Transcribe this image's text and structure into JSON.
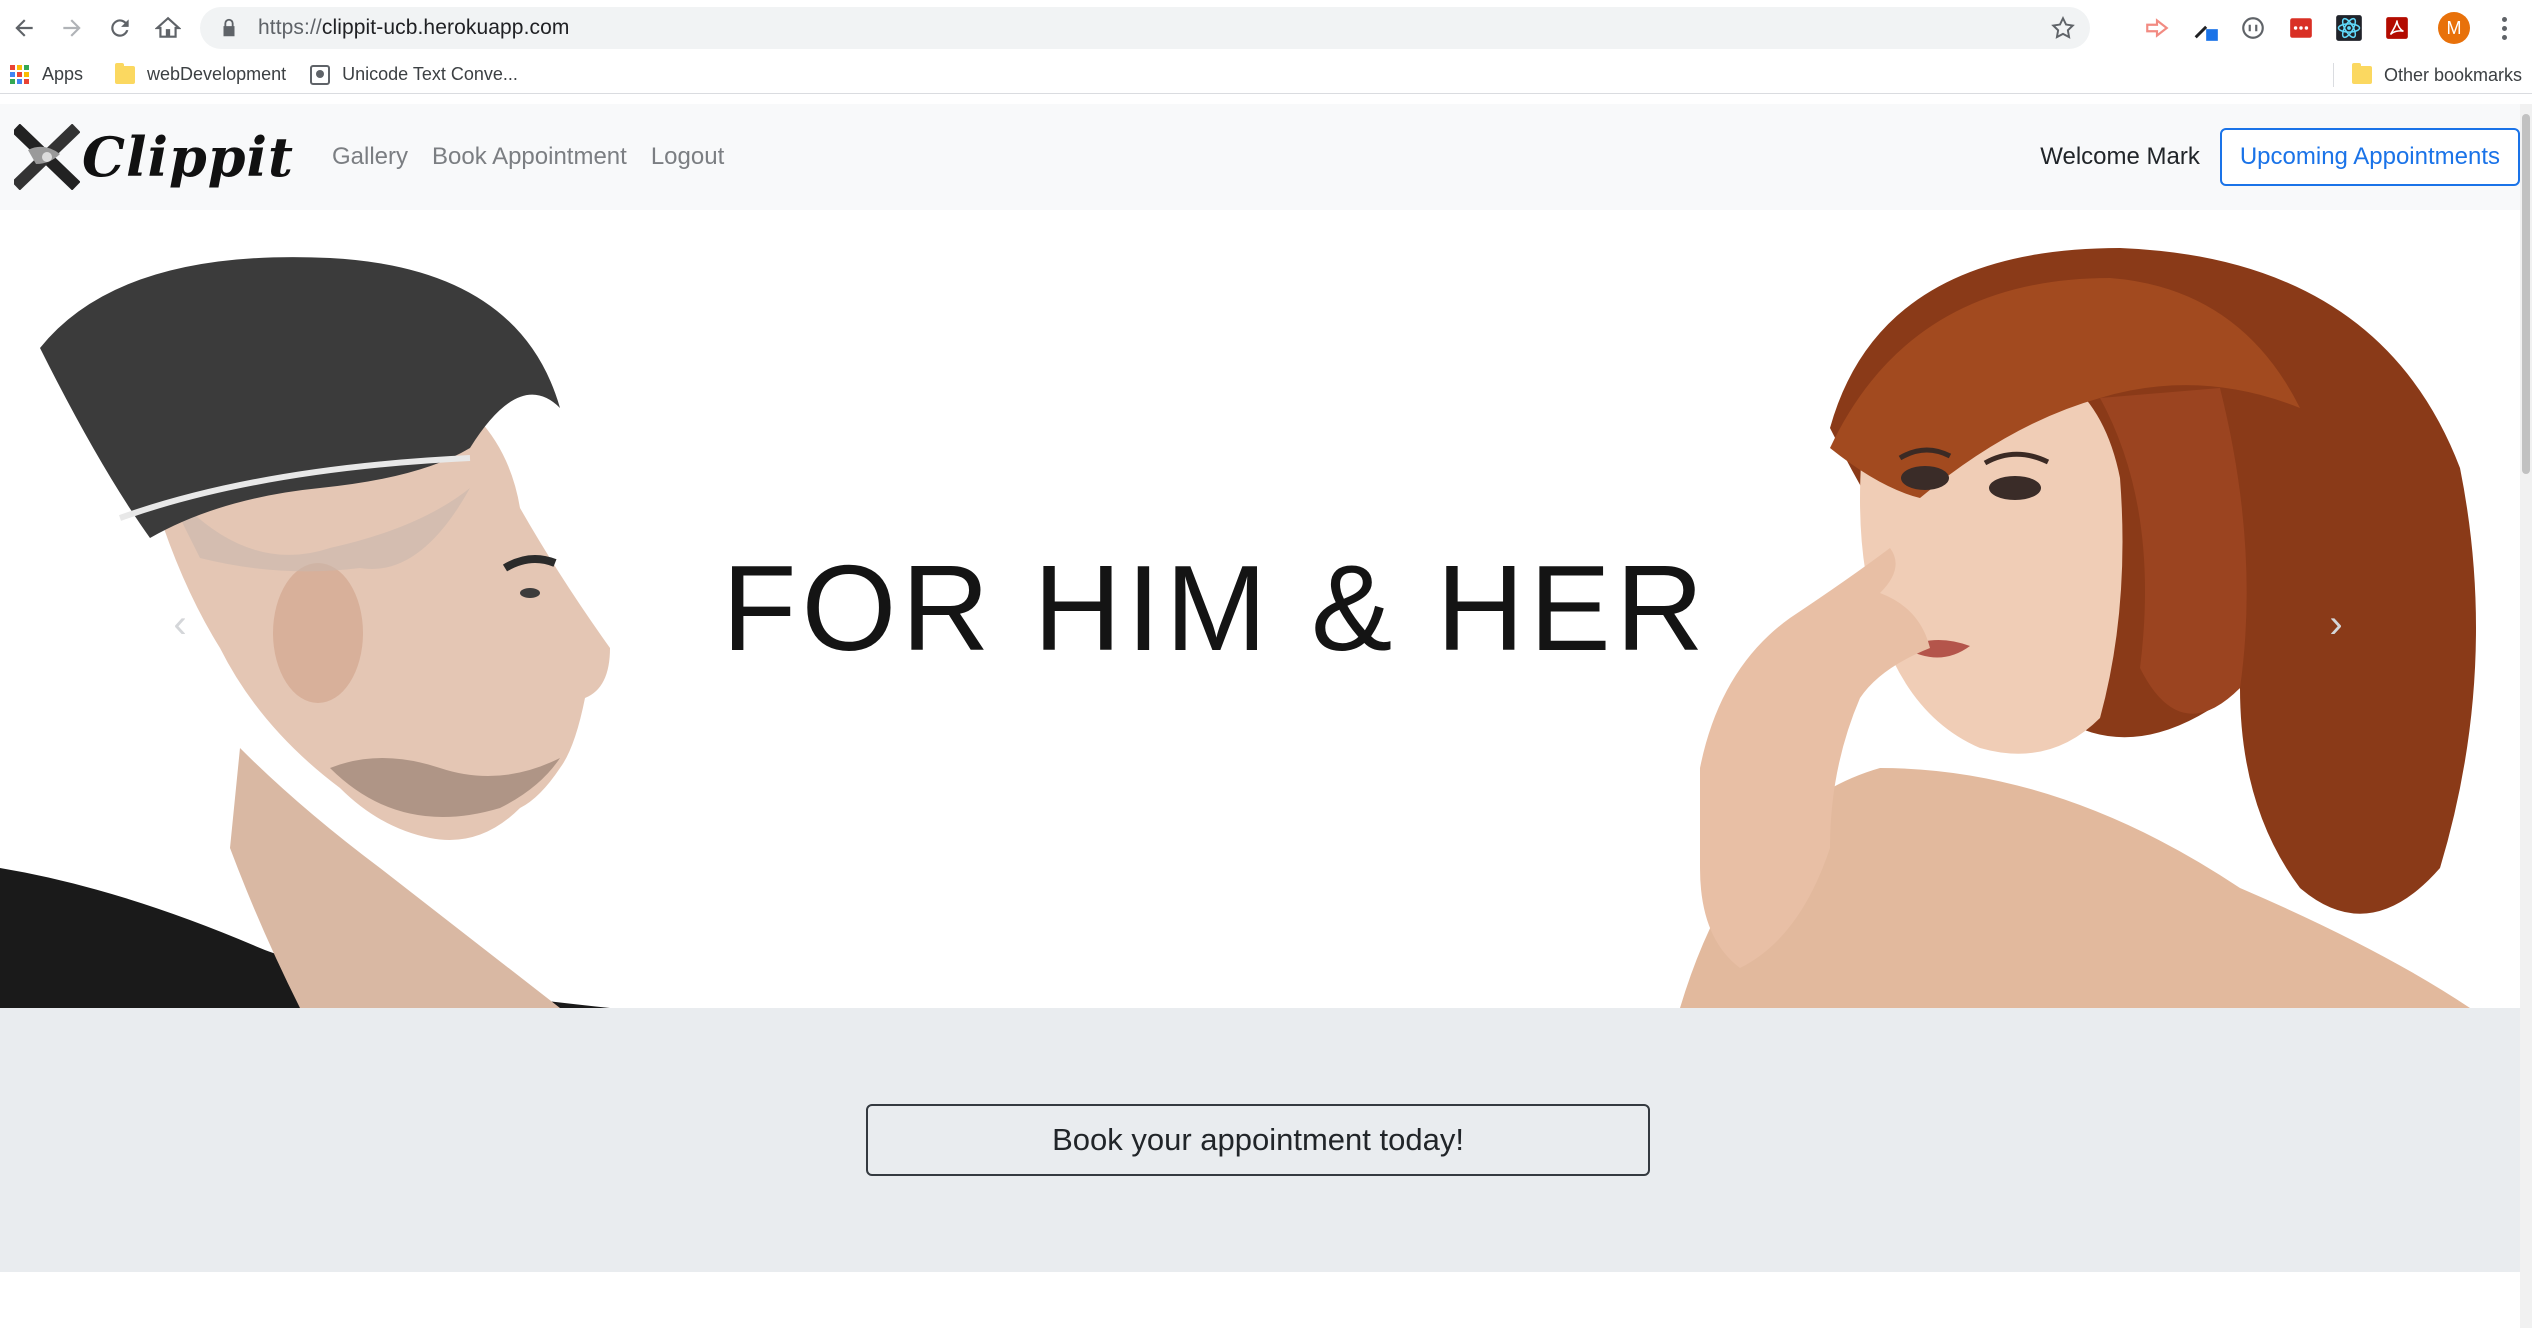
{
  "browser": {
    "url_scheme": "https://",
    "url_host": "clippit-ucb.herokuapp.com",
    "profile_initial": "M",
    "bookmarks": [
      {
        "label": "Apps",
        "icon": "apps-grid-icon"
      },
      {
        "label": "webDevelopment",
        "icon": "folder-icon"
      },
      {
        "label": "Unicode Text Conve...",
        "icon": "page-icon"
      }
    ],
    "other_bookmarks": "Other bookmarks"
  },
  "site": {
    "brand": "Clippit",
    "nav_links": [
      "Gallery",
      "Book Appointment",
      "Logout"
    ],
    "welcome": "Welcome Mark",
    "upcoming_button": "Upcoming Appointments"
  },
  "hero": {
    "headline": "FOR HIM & HER",
    "prev_glyph": "‹",
    "next_glyph": "›"
  },
  "cta": {
    "button": "Book your appointment today!"
  },
  "colors": {
    "accent": "#1a73e8",
    "navbar_bg": "#f8f9fa",
    "band_bg": "#e9ecef"
  }
}
